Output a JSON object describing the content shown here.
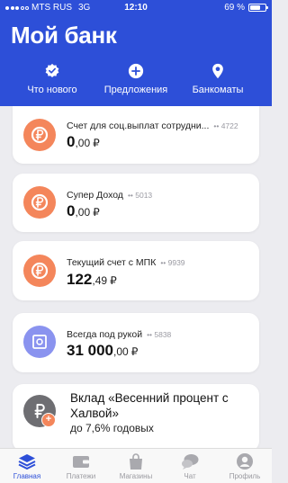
{
  "status_bar": {
    "carrier": "MTS RUS",
    "network": "3G",
    "time": "12:10",
    "battery": "69 %",
    "battery_level": 0.69
  },
  "app_title": "Мой банк",
  "quick_actions": [
    {
      "label": "Что нового",
      "icon": "check-badge-icon"
    },
    {
      "label": "Предложения",
      "icon": "plus-circle-icon"
    },
    {
      "label": "Банкоматы",
      "icon": "map-pin-icon"
    }
  ],
  "accounts": [
    {
      "name": "Счет для соц.выплат сотрудни...",
      "mask": "•• 4722",
      "balance_int": "0",
      "balance_dec": ",00",
      "currency": "₽",
      "icon": "ruble-coin-icon"
    },
    {
      "name": "Супер Доход",
      "mask": "•• 5013",
      "balance_int": "0",
      "balance_dec": ",00",
      "currency": "₽",
      "icon": "ruble-coin-icon"
    },
    {
      "name": "Текущий счет с МПК",
      "mask": "•• 9939",
      "balance_int": "122",
      "balance_dec": ",49",
      "currency": "₽",
      "icon": "ruble-coin-icon"
    },
    {
      "name": "Всегда под рукой",
      "mask": "•• 5838",
      "balance_int": "31 000",
      "balance_dec": ",00",
      "currency": "₽",
      "icon": "safe-icon"
    }
  ],
  "promo": {
    "title": "Вклад «Весенний процент с Халвой»",
    "subtitle": "до 7,6% годовых",
    "badge": "+",
    "icon": "ruble-deposit-icon"
  },
  "tabs": [
    {
      "label": "Главная",
      "icon": "layers-icon",
      "active": true
    },
    {
      "label": "Платежи",
      "icon": "wallet-icon",
      "active": false
    },
    {
      "label": "Магазины",
      "icon": "shopping-bag-icon",
      "active": false
    },
    {
      "label": "Чат",
      "icon": "chat-bubbles-icon",
      "active": false
    },
    {
      "label": "Профиль",
      "icon": "profile-icon",
      "active": false
    }
  ],
  "colors": {
    "brand_blue": "#2d4fd8",
    "account_orange": "#f4865b",
    "safe_purple": "#8a93ef",
    "tab_inactive": "#9a9aa0",
    "background": "#ececf0"
  }
}
